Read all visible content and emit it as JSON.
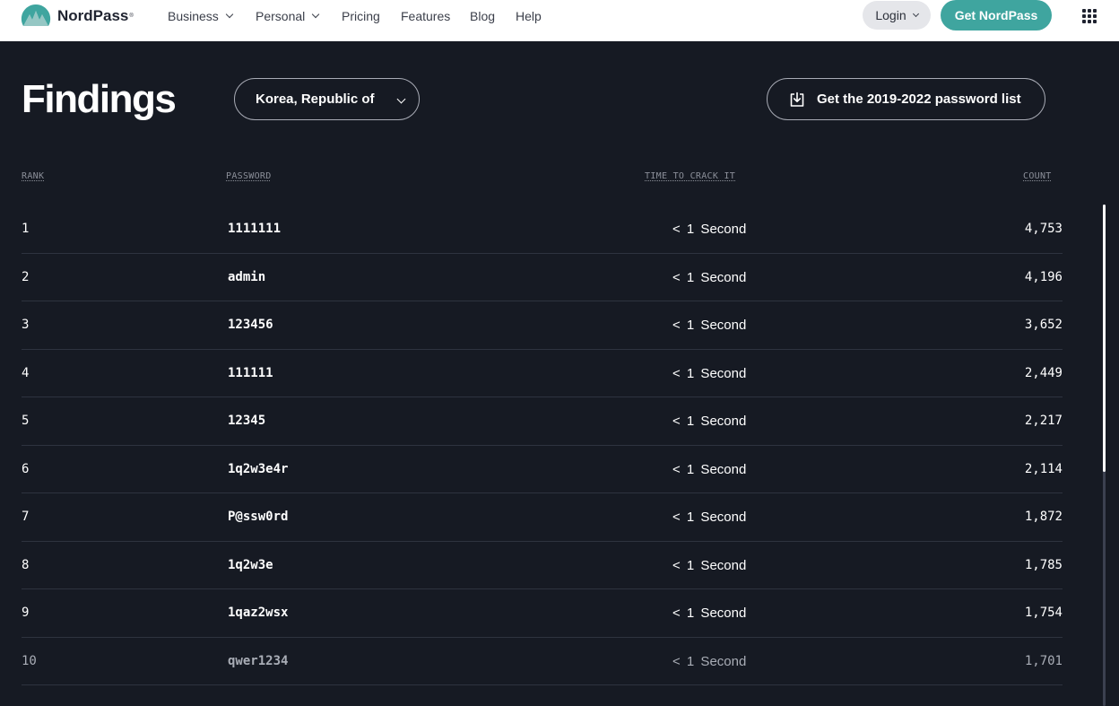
{
  "nav": {
    "brand": "NordPass",
    "brand_reg": "®",
    "items": [
      {
        "label": "Business",
        "dropdown": true
      },
      {
        "label": "Personal",
        "dropdown": true
      },
      {
        "label": "Pricing",
        "dropdown": false
      },
      {
        "label": "Features",
        "dropdown": false
      },
      {
        "label": "Blog",
        "dropdown": false
      },
      {
        "label": "Help",
        "dropdown": false
      }
    ],
    "login_label": "Login",
    "cta_label": "Get NordPass"
  },
  "header": {
    "title": "Findings",
    "country_select": "Korea, Republic of",
    "download_label": "Get the 2019-2022 password list"
  },
  "table": {
    "columns": [
      "RANK",
      "PASSWORD",
      "TIME TO CRACK IT",
      "COUNT"
    ],
    "rows": [
      {
        "rank": "1",
        "password": "1111111",
        "time": "< 1 Second",
        "count": "4,753"
      },
      {
        "rank": "2",
        "password": "admin",
        "time": "< 1 Second",
        "count": "4,196"
      },
      {
        "rank": "3",
        "password": "123456",
        "time": "< 1 Second",
        "count": "3,652"
      },
      {
        "rank": "4",
        "password": "111111",
        "time": "< 1 Second",
        "count": "2,449"
      },
      {
        "rank": "5",
        "password": "12345",
        "time": "< 1 Second",
        "count": "2,217"
      },
      {
        "rank": "6",
        "password": "1q2w3e4r",
        "time": "< 1 Second",
        "count": "2,114"
      },
      {
        "rank": "7",
        "password": "P@ssw0rd",
        "time": "< 1 Second",
        "count": "1,872"
      },
      {
        "rank": "8",
        "password": "1q2w3e",
        "time": "< 1 Second",
        "count": "1,785"
      },
      {
        "rank": "9",
        "password": "1qaz2wsx",
        "time": "< 1 Second",
        "count": "1,754"
      },
      {
        "rank": "10",
        "password": "qwer1234",
        "time": "< 1 Second",
        "count": "1,701"
      }
    ]
  },
  "colors": {
    "background": "#161a23",
    "accent": "#3fa59f",
    "nav_background": "#ffffff"
  },
  "icons": {
    "logo": "nordpass-mountain-logo",
    "download": "download-icon",
    "dropdown": "chevron-down-icon",
    "apps": "grid-menu-icon"
  }
}
